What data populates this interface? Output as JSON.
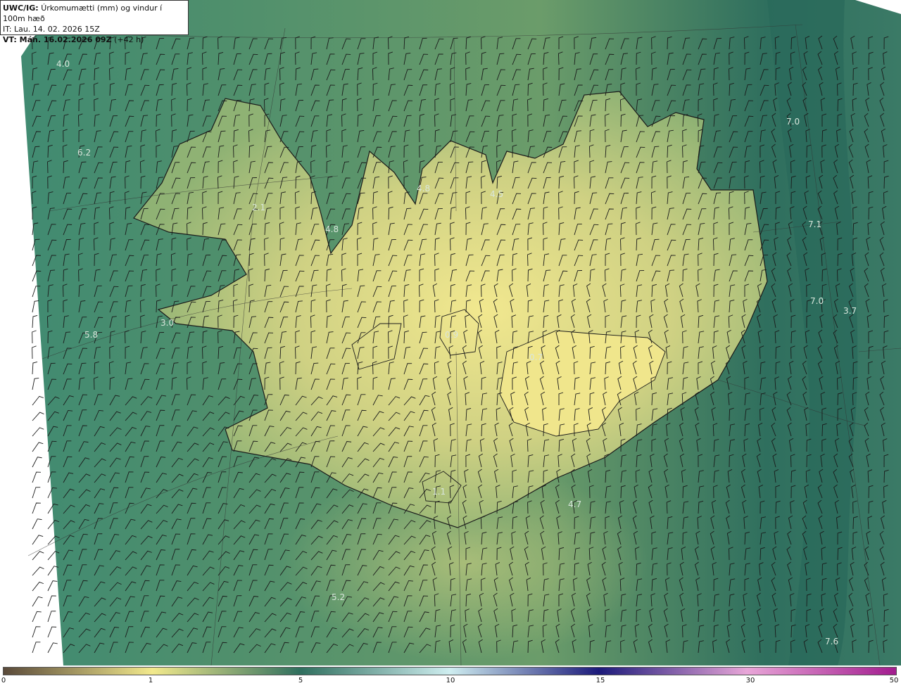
{
  "header": {
    "product_code": "UWC/IG:",
    "title": "Úrkomumætti (mm) og vindur í 100m hæð",
    "init_time": "IT: Lau. 14. 02. 2026 15Z",
    "valid_prefix": "VT: Mán. 16.02.2026 09Z",
    "lead": "(+42 h)"
  },
  "map_labels": [
    {
      "id": "lbl-1",
      "text": "4.0"
    },
    {
      "id": "lbl-2",
      "text": "6.2"
    },
    {
      "id": "lbl-3",
      "text": "2.1"
    },
    {
      "id": "lbl-4",
      "text": "4.8"
    },
    {
      "id": "lbl-5",
      "text": "4.8"
    },
    {
      "id": "lbl-6",
      "text": "4.5"
    },
    {
      "id": "lbl-7",
      "text": "7.0"
    },
    {
      "id": "lbl-8",
      "text": "7.1"
    },
    {
      "id": "lbl-9",
      "text": "7.0"
    },
    {
      "id": "lbl-10",
      "text": "3.7"
    },
    {
      "id": "lbl-11",
      "text": "3.0"
    },
    {
      "id": "lbl-12",
      "text": "5.8"
    },
    {
      "id": "lbl-13",
      "text": "0.9"
    },
    {
      "id": "lbl-14",
      "text": "0.7"
    },
    {
      "id": "lbl-15",
      "text": "4.7"
    },
    {
      "id": "lbl-16",
      "text": "5.2"
    },
    {
      "id": "lbl-17",
      "text": "7.6"
    },
    {
      "id": "lbl-18",
      "text": "1.1"
    }
  ],
  "colorbar": {
    "ticks": [
      "0",
      "1",
      "5",
      "10",
      "15",
      "30",
      "50"
    ],
    "colors": [
      "#5a4a3a",
      "#f2e98c",
      "#2f6f5e",
      "#cfeef0",
      "#1c1a7a",
      "#e8a6d8",
      "#a21c8e"
    ]
  },
  "colors": {
    "sea_dark": "#2f6f5e",
    "sea_mid": "#4e8a6c",
    "land_light": "#f0e68c",
    "coast_line": "#1a1a1a"
  }
}
